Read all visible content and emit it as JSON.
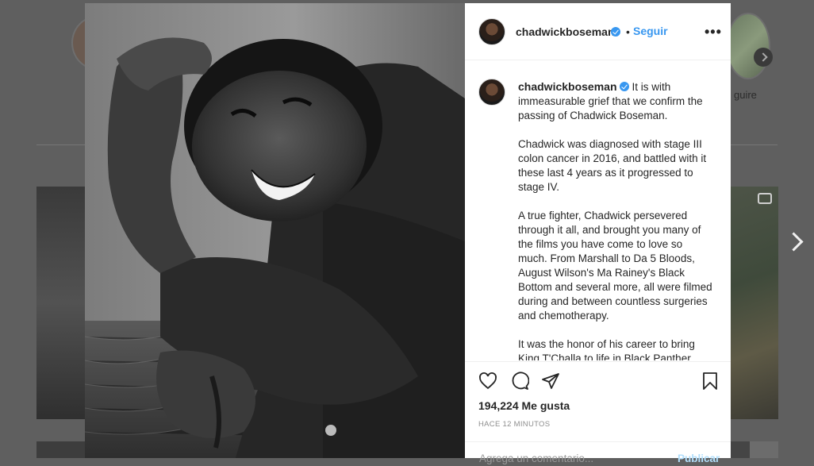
{
  "background": {
    "story_label": "guire"
  },
  "post": {
    "username": "chadwickboseman",
    "follow_label": "Seguir",
    "dot": "•",
    "more_label": "•••",
    "caption": {
      "lead": "It is with immeasurable grief that we confirm the passing of Chadwick Boseman.",
      "paragraphs": [
        "Chadwick was diagnosed with stage III colon cancer in 2016, and battled with it these last 4 years as it progressed to stage IV.",
        "A true fighter, Chadwick persevered through it all, and brought you many of the films you have come to love so much. From Marshall to Da 5 Bloods, August Wilson's Ma Rainey's Black Bottom and several more, all were filmed during and between countless surgeries and chemotherapy.",
        "It was the honor of his career to bring King T'Challa to life in Black Panther."
      ]
    },
    "likes_text": "194,224 Me gusta",
    "time_text": "HACE 12 MINUTOS",
    "comment_placeholder": "Agrega un comentario...",
    "publish_label": "Publicar",
    "colors": {
      "accent": "#3897f0",
      "text": "#262626",
      "muted": "#8e8e8e"
    },
    "icons": [
      "heart-icon",
      "comment-icon",
      "share-icon",
      "bookmark-icon",
      "verified-badge-icon",
      "chevron-right-icon",
      "camera-icon"
    ]
  }
}
